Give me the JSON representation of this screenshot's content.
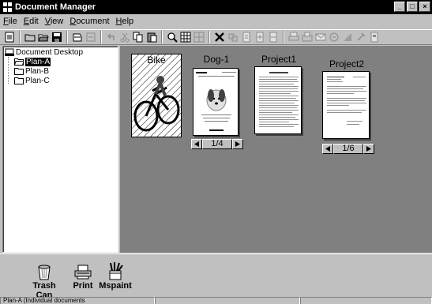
{
  "window": {
    "title": "Document Manager"
  },
  "menu": [
    "File",
    "Edit",
    "View",
    "Document",
    "Help"
  ],
  "toolbar": {
    "icons": [
      "new-icon",
      "open-folder-icon",
      "open-icon",
      "save-icon",
      "scan-icon",
      "send-icon",
      "undo-icon",
      "cut-icon",
      "copy-icon",
      "paste-icon",
      "zoom-icon",
      "grid-view-icon",
      "thumbnail-icon",
      "delete-icon",
      "link-icon",
      "page-icon",
      "page-insert-icon",
      "page-extract-icon",
      "print-icon",
      "fax-icon",
      "mail-icon",
      "ocr-icon",
      "stamp-icon",
      "properties-icon",
      "document-icon"
    ]
  },
  "tree": {
    "root": "Document Desktop",
    "items": [
      "Plan-A",
      "Plan-B",
      "Plan-C"
    ],
    "selected": "Plan-A"
  },
  "documents": [
    {
      "title": "Bike"
    },
    {
      "title": "Dog-1",
      "page_label": "1/4"
    },
    {
      "title": "Project1"
    },
    {
      "title": "Project2",
      "page_label": "1/6"
    }
  ],
  "tray": [
    {
      "label": "Trash Can",
      "icon": "trash-can-icon"
    },
    {
      "label": "Print",
      "icon": "printer-icon"
    },
    {
      "label": "Mspaint",
      "icon": "paint-brushes-icon"
    }
  ],
  "status": {
    "text": "Plan-A (Individual documents"
  }
}
